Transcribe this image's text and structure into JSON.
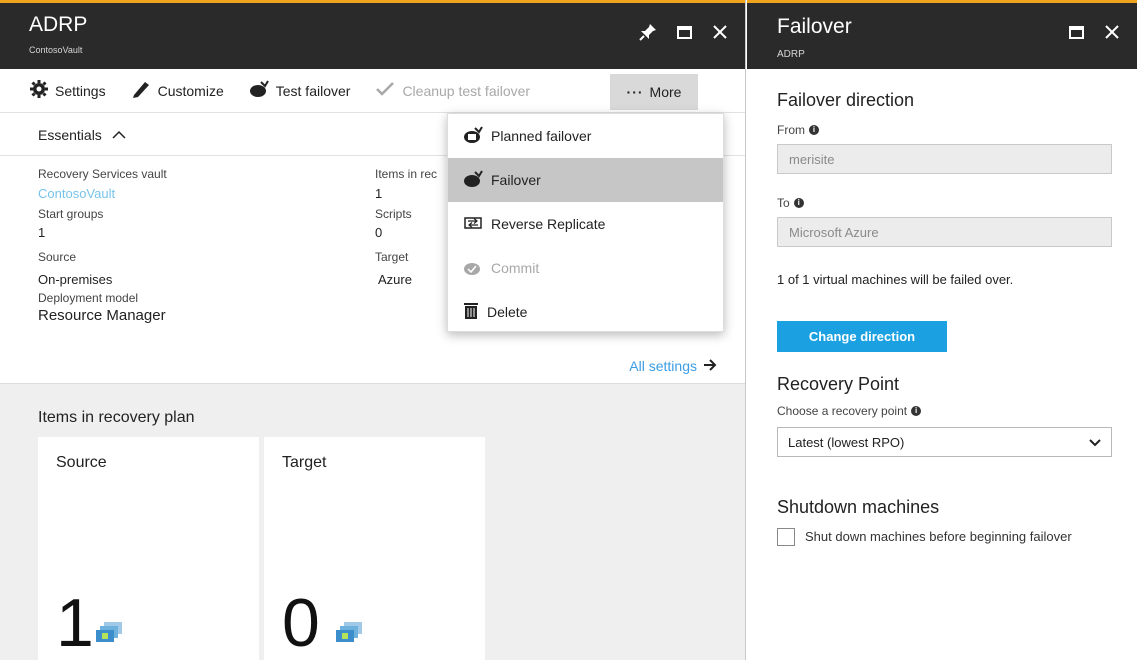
{
  "left_blade": {
    "title": "ADRP",
    "subtitle": "ContosoVault",
    "header_icons": [
      "pin-icon",
      "maximize-icon",
      "close-icon"
    ],
    "commands": {
      "settings": "Settings",
      "customize": "Customize",
      "test_failover": "Test failover",
      "cleanup_test_failover": "Cleanup test failover",
      "more": "More"
    },
    "essentials_label": "Essentials",
    "essentials": {
      "vault_label": "Recovery Services vault",
      "vault_value": "ContosoVault",
      "items_label": "Items in rec",
      "items_value": "1",
      "start_groups_label": "Start groups",
      "start_groups_value": "1",
      "scripts_label": "Scripts",
      "scripts_value": "0",
      "source_label": "Source",
      "source_value": "On-premises",
      "target_label": "Target",
      "target_value": "Azure",
      "deployment_label": "Deployment model",
      "deployment_value": "Resource Manager"
    },
    "all_settings": "All settings",
    "items_section_title": "Items in recovery plan",
    "tiles": [
      {
        "title": "Source",
        "count": "1"
      },
      {
        "title": "Target",
        "count": "0"
      }
    ]
  },
  "more_menu": {
    "items": [
      {
        "label": "Planned failover",
        "icon": "planned-failover-icon",
        "state": "normal"
      },
      {
        "label": "Failover",
        "icon": "failover-icon",
        "state": "selected"
      },
      {
        "label": "Reverse Replicate",
        "icon": "reverse-replicate-icon",
        "state": "normal"
      },
      {
        "label": "Commit",
        "icon": "commit-icon",
        "state": "disabled"
      },
      {
        "label": "Delete",
        "icon": "trash-icon",
        "state": "normal"
      }
    ]
  },
  "right_blade": {
    "title": "Failover",
    "subtitle": "ADRP",
    "header_icons": [
      "maximize-icon",
      "close-icon"
    ],
    "failover_direction_title": "Failover direction",
    "from_label": "From",
    "from_value": "merisite",
    "to_label": "To",
    "to_value": "Microsoft Azure",
    "vm_message": "1 of 1 virtual machines will be failed over.",
    "change_direction_button": "Change direction",
    "recovery_point_title": "Recovery Point",
    "recovery_point_label": "Choose a recovery point",
    "recovery_point_selected": "Latest (lowest RPO)",
    "shutdown_title": "Shutdown machines",
    "shutdown_checkbox_label": "Shut down machines before beginning failover",
    "shutdown_checked": false
  },
  "colors": {
    "header_bg": "#2a2a2a",
    "header_accent": "#f0a31d",
    "primary_button": "#1ba1e2",
    "link": "#3b9de4",
    "menu_selected": "#c6c6c6"
  }
}
